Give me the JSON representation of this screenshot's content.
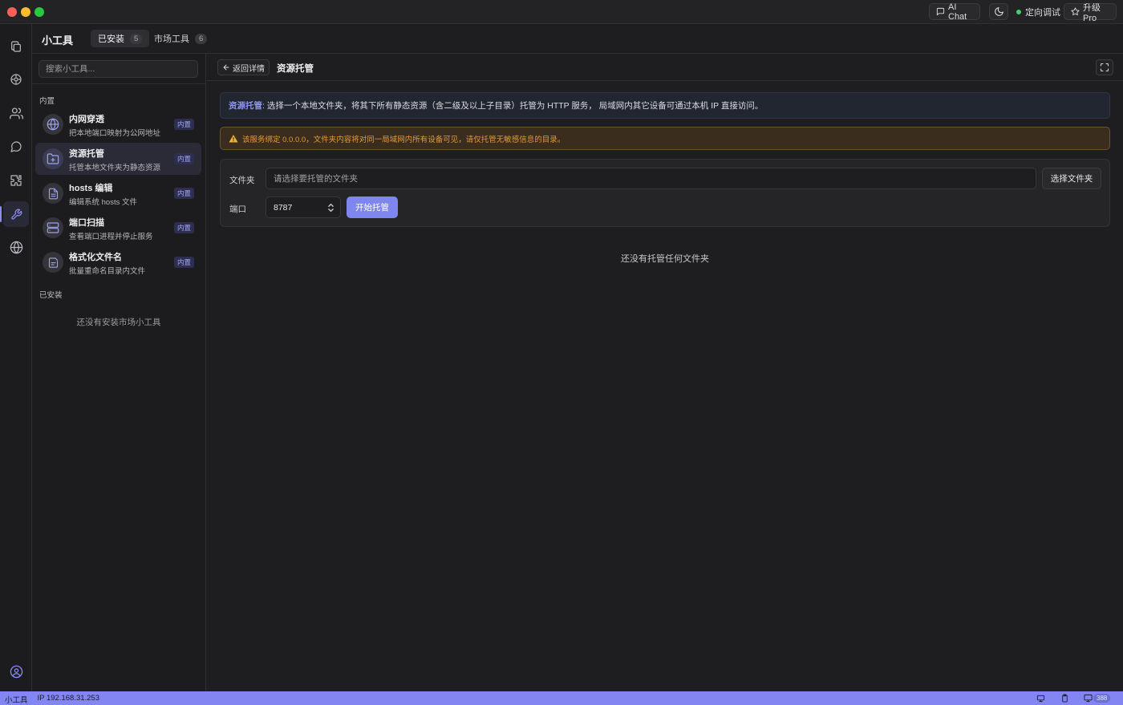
{
  "titlebar": {
    "ai_chat_label": "AI Chat",
    "status_label": "定向调试",
    "status_color": "#3fd16b",
    "pro_label": "升级 Pro"
  },
  "header": {
    "title": "小工具",
    "tabs": [
      {
        "label": "已安装",
        "count": "5",
        "active": true
      },
      {
        "label": "市场工具",
        "count": "6",
        "active": false
      }
    ]
  },
  "activity_bar": {
    "items": [
      "copy-icon",
      "target-icon",
      "users-icon",
      "chat-icon",
      "puzzle-icon",
      "wrench-icon",
      "globe-icon"
    ],
    "active_item": "wrench-icon",
    "bottom_item": "user-circle-icon"
  },
  "sidebar": {
    "search_placeholder": "搜索小工具...",
    "builtin_section": "内置",
    "installed_section": "已安装",
    "empty_installed": "还没有安装市场小工具",
    "items": [
      {
        "name": "内网穿透",
        "desc": "把本地端口映射为公网地址",
        "badge": "内置",
        "icon": "globe-icon"
      },
      {
        "name": "资源托管",
        "desc": "托管本地文件夹为静态资源",
        "badge": "内置",
        "icon": "folder-plus-icon",
        "active": true
      },
      {
        "name": "hosts 编辑",
        "desc": "编辑系统 hosts 文件",
        "badge": "内置",
        "icon": "file-text-icon"
      },
      {
        "name": "端口扫描",
        "desc": "查看端口进程并停止服务",
        "badge": "内置",
        "icon": "server-icon"
      },
      {
        "name": "格式化文件名",
        "desc": "批量重命名目录内文件",
        "badge": "内置",
        "icon": "file-rename-icon"
      }
    ]
  },
  "main": {
    "back_label": "返回详情",
    "title": "资源托管",
    "info": {
      "strong": "资源托管",
      "text": ": 选择一个本地文件夹，将其下所有静态资源（含二级及以上子目录）托管为 HTTP 服务， 局域网内其它设备可通过本机 IP 直接访问。"
    },
    "warning": "该服务绑定 0.0.0.0，文件夹内容将对同一局域网内所有设备可见，请仅托管无敏感信息的目录。",
    "form": {
      "folder_label": "文件夹",
      "folder_placeholder": "请选择要托管的文件夹",
      "folder_value": "",
      "select_folder_label": "选择文件夹",
      "port_label": "端口",
      "port_value": "8787",
      "start_label": "开始托管"
    },
    "empty_text": "还没有托管任何文件夹"
  },
  "statusbar": {
    "app_label": "小工具",
    "ip_label": "IP 192.168.31.253",
    "count": "388"
  },
  "colors": {
    "accent": "#8386f2",
    "warning": "#e0993e"
  }
}
